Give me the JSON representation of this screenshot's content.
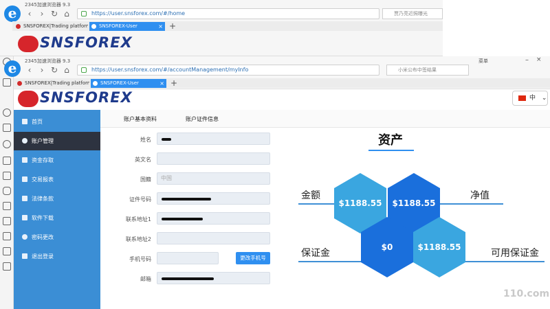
{
  "browser": {
    "title": "2345加速浏览器 9.3",
    "back_url": "https://user.snsforex.com/#/home",
    "back_search": "贾乃亮近照曝光",
    "url": "https://user.snsforex.com/#/accountManagement/myInfo",
    "search": "小米公布中签结果",
    "menu_label": "菜单",
    "tabs": [
      {
        "label": "SNSFOREX|Trading platform"
      },
      {
        "label": "SNSFOREX-User"
      }
    ]
  },
  "brand": {
    "name": "SNSFOREX"
  },
  "lang": {
    "label": "中"
  },
  "sidebar": {
    "items": [
      {
        "label": "首页"
      },
      {
        "label": "账户管理"
      },
      {
        "label": "资金存取"
      },
      {
        "label": "交易报表"
      },
      {
        "label": "法律条款"
      },
      {
        "label": "软件下载"
      },
      {
        "label": "密码更改"
      },
      {
        "label": "退出登录"
      }
    ],
    "active_index": 1
  },
  "page_tabs": [
    {
      "label": "账户基本资料"
    },
    {
      "label": "账户证件信息"
    }
  ],
  "form": {
    "fields": [
      {
        "label": "姓名",
        "value": ""
      },
      {
        "label": "英文名",
        "value": ""
      },
      {
        "label": "国籍",
        "value": "中国"
      },
      {
        "label": "证件号码",
        "value": ""
      },
      {
        "label": "联系地址1",
        "value": ""
      },
      {
        "label": "联系地址2",
        "value": ""
      },
      {
        "label": "手机号码",
        "value": ""
      },
      {
        "label": "邮箱",
        "value": ""
      }
    ],
    "change_phone_label": "更改手机号"
  },
  "assets": {
    "title": "资产",
    "labels": {
      "amount": "金额",
      "equity": "净值",
      "margin": "保证金",
      "available_margin": "可用保证金"
    },
    "values": {
      "amount": "$1188.55",
      "equity": "$1188.55",
      "margin": "$0",
      "available_margin": "$1188.55"
    }
  },
  "watermark": "110.com",
  "colors": {
    "brand_blue": "#1f3b8c",
    "brand_red": "#d6252b",
    "sidebar": "#3b8ed5",
    "sidebar_active": "#2d3340",
    "hex_light": "#3aa6e0",
    "hex_dark": "#1a6fdc",
    "accent": "#2f8ff0"
  }
}
